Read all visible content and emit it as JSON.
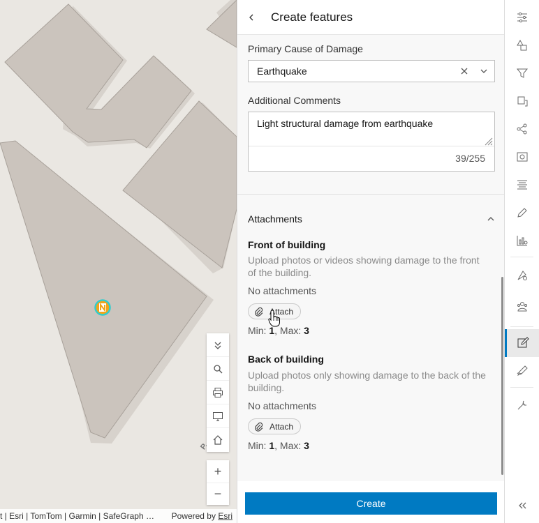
{
  "map": {
    "attribution": "oft | Esri | TomTom | Garmin | SafeGraph …",
    "powered_by": "Powered by",
    "powered_by_link": "Esri",
    "street_label": "P... Ave",
    "tools": [
      {
        "name": "collapse-icon",
        "title": "Collapse"
      },
      {
        "name": "search-icon",
        "title": "Search"
      },
      {
        "name": "print-icon",
        "title": "Print"
      },
      {
        "name": "fullscreen-icon",
        "title": "Full screen"
      },
      {
        "name": "home-icon",
        "title": "Home"
      }
    ],
    "zoom_in": "+",
    "zoom_out": "−"
  },
  "panel": {
    "title": "Create features",
    "fields": {
      "cause_label": "Primary Cause of Damage",
      "cause_value": "Earthquake",
      "comments_label": "Additional Comments",
      "comments_value": "Light structural damage from earthquake",
      "comments_count": "39/255"
    },
    "attachments": {
      "section_title": "Attachments",
      "groups": [
        {
          "title": "Front of building",
          "description": "Upload photos or videos showing damage to the front of the building.",
          "status": "No attachments",
          "button": "Attach",
          "min_label": "Min: ",
          "min_value": "1",
          "max_label": ", Max: ",
          "max_value": "3"
        },
        {
          "title": "Back of building",
          "description": "Upload photos only showing damage to the back of the building.",
          "status": "No attachments",
          "button": "Attach",
          "min_label": "Min: ",
          "min_value": "1",
          "max_label": ", Max: ",
          "max_value": "3"
        }
      ]
    },
    "create_button": "Create"
  },
  "actionbar": {
    "items": [
      {
        "icon": "sliders-icon"
      },
      {
        "icon": "shapes-icon"
      },
      {
        "icon": "filter-icon"
      },
      {
        "icon": "layer-edit-icon"
      },
      {
        "icon": "network-icon"
      },
      {
        "icon": "camera-settings-icon"
      },
      {
        "icon": "list-icon"
      },
      {
        "icon": "pencil-icon"
      },
      {
        "icon": "chart-icon"
      },
      {
        "icon": "measure-icon"
      },
      {
        "icon": "people-icon"
      },
      {
        "icon": "edit-square-icon"
      },
      {
        "icon": "sketch-icon"
      },
      {
        "icon": "wrench-icon"
      },
      {
        "icon": "collapse-chevrons-icon"
      }
    ],
    "active_index": 11
  },
  "colors": {
    "brand_blue": "#007ac2",
    "building_fill": "#cbc4bd",
    "building_stroke": "#a8a19a",
    "map_background": "#eae7e2",
    "marker_ring": "#33cccc",
    "marker_fill": "#f2a51a"
  }
}
